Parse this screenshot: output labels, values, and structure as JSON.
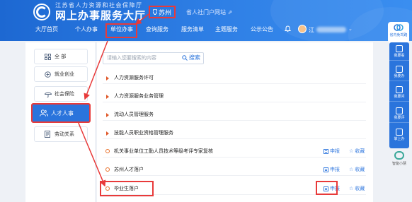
{
  "header": {
    "subtitle": "江苏省人力资源和社会保障厅",
    "title": "网上办事服务大厅",
    "city": "苏州",
    "portal_link": "省人社门户网站"
  },
  "nav": {
    "items": [
      "大厅首页",
      "个人办事",
      "单位办事",
      "查询服务",
      "服务清单",
      "主题服务",
      "公示公告"
    ],
    "active": "单位办事",
    "user_prefix": "江",
    "user_caret": "⌄"
  },
  "categories": [
    {
      "label": "全 部",
      "icon": "grid-icon"
    },
    {
      "label": "就业创业",
      "icon": "briefcase-icon"
    },
    {
      "label": "社会保险",
      "icon": "umbrella-icon"
    },
    {
      "label": "人才人事",
      "icon": "people-icon",
      "active": true
    },
    {
      "label": "劳动关系",
      "icon": "document-icon"
    }
  ],
  "search": {
    "placeholder": "请输入您要搜索的内容",
    "button": "搜索"
  },
  "services": [
    {
      "name": "人力资源服务许可",
      "type": "group"
    },
    {
      "name": "人力资源服务业务管理",
      "type": "group"
    },
    {
      "name": "流动人员管理服务",
      "type": "group"
    },
    {
      "name": "技能人员职业资格管理服务",
      "type": "group"
    },
    {
      "name": "机关事业单位工勤人员技术等级考评专家复核",
      "type": "item",
      "apply": "申报",
      "favorite": "收藏"
    },
    {
      "name": "苏州人才落户",
      "type": "item",
      "apply": "申报",
      "favorite": "收藏"
    },
    {
      "name": "毕业生落户",
      "type": "item",
      "apply": "申报",
      "favorite": "收藏",
      "highlight": true
    }
  ],
  "right_toolbar": {
    "top": "省内免驾路",
    "items": [
      "我要看",
      "我要办",
      "我要问",
      "我要评",
      "掌上办"
    ],
    "robot": "智能小慧"
  },
  "colors": {
    "primary": "#2a74dc",
    "highlight": "#e83a3a",
    "accent_orange": "#e05a2b"
  }
}
